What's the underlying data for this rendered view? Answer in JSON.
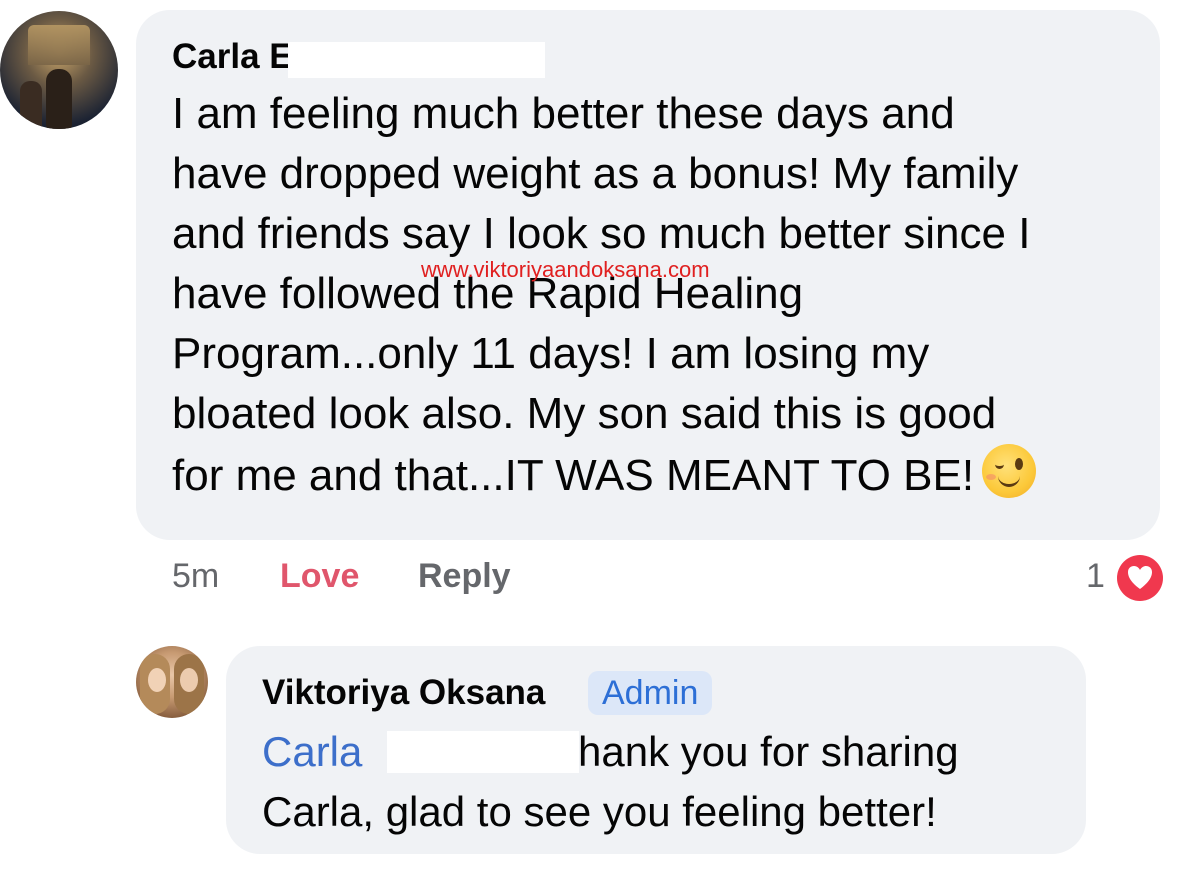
{
  "comment": {
    "author": "Carla E",
    "text": "I am feeling much better these days and\nhave dropped weight as a bonus!  My family\nand friends say I look so much better since I\nhave followed the Rapid Healing\nProgram...only 11 days!  I am losing my\nbloated look also.  My son said this is good\nfor me and that...IT WAS MEANT TO BE!",
    "emoji": "winking-face-emoji",
    "time": "5m",
    "love_label": "Love",
    "reply_label": "Reply",
    "reaction_count": "1",
    "reaction_icon": "heart-icon"
  },
  "watermark": "www.viktoriyaandoksana.com",
  "reply": {
    "author": "Viktoriya Oksana",
    "badge": "Admin",
    "mention": "Carla",
    "text": "thank you for sharing Carla, glad to see you feeling better!"
  },
  "colors": {
    "bubble": "#f0f2f5",
    "love": "#e0566c",
    "mention": "#3d6fca",
    "badge_bg": "#dce7f8",
    "watermark": "#e02020"
  }
}
